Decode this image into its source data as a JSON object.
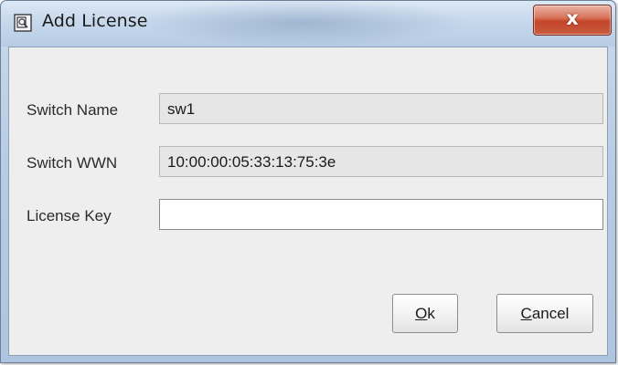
{
  "window": {
    "title": "Add License",
    "icon": "dialog-app-icon",
    "close_label": "x"
  },
  "form": {
    "switch_name": {
      "label": "Switch Name",
      "value": "sw1"
    },
    "switch_wwn": {
      "label": "Switch WWN",
      "value": "10:00:00:05:33:13:75:3e"
    },
    "license_key": {
      "label": "License Key",
      "value": ""
    }
  },
  "buttons": {
    "ok": {
      "mnemonic": "O",
      "rest": "k"
    },
    "cancel": {
      "mnemonic": "C",
      "rest": "ancel"
    }
  },
  "colors": {
    "titlebar": "#c6d8ec",
    "client_bg": "#eeeeee",
    "close_button": "#c4452a"
  }
}
